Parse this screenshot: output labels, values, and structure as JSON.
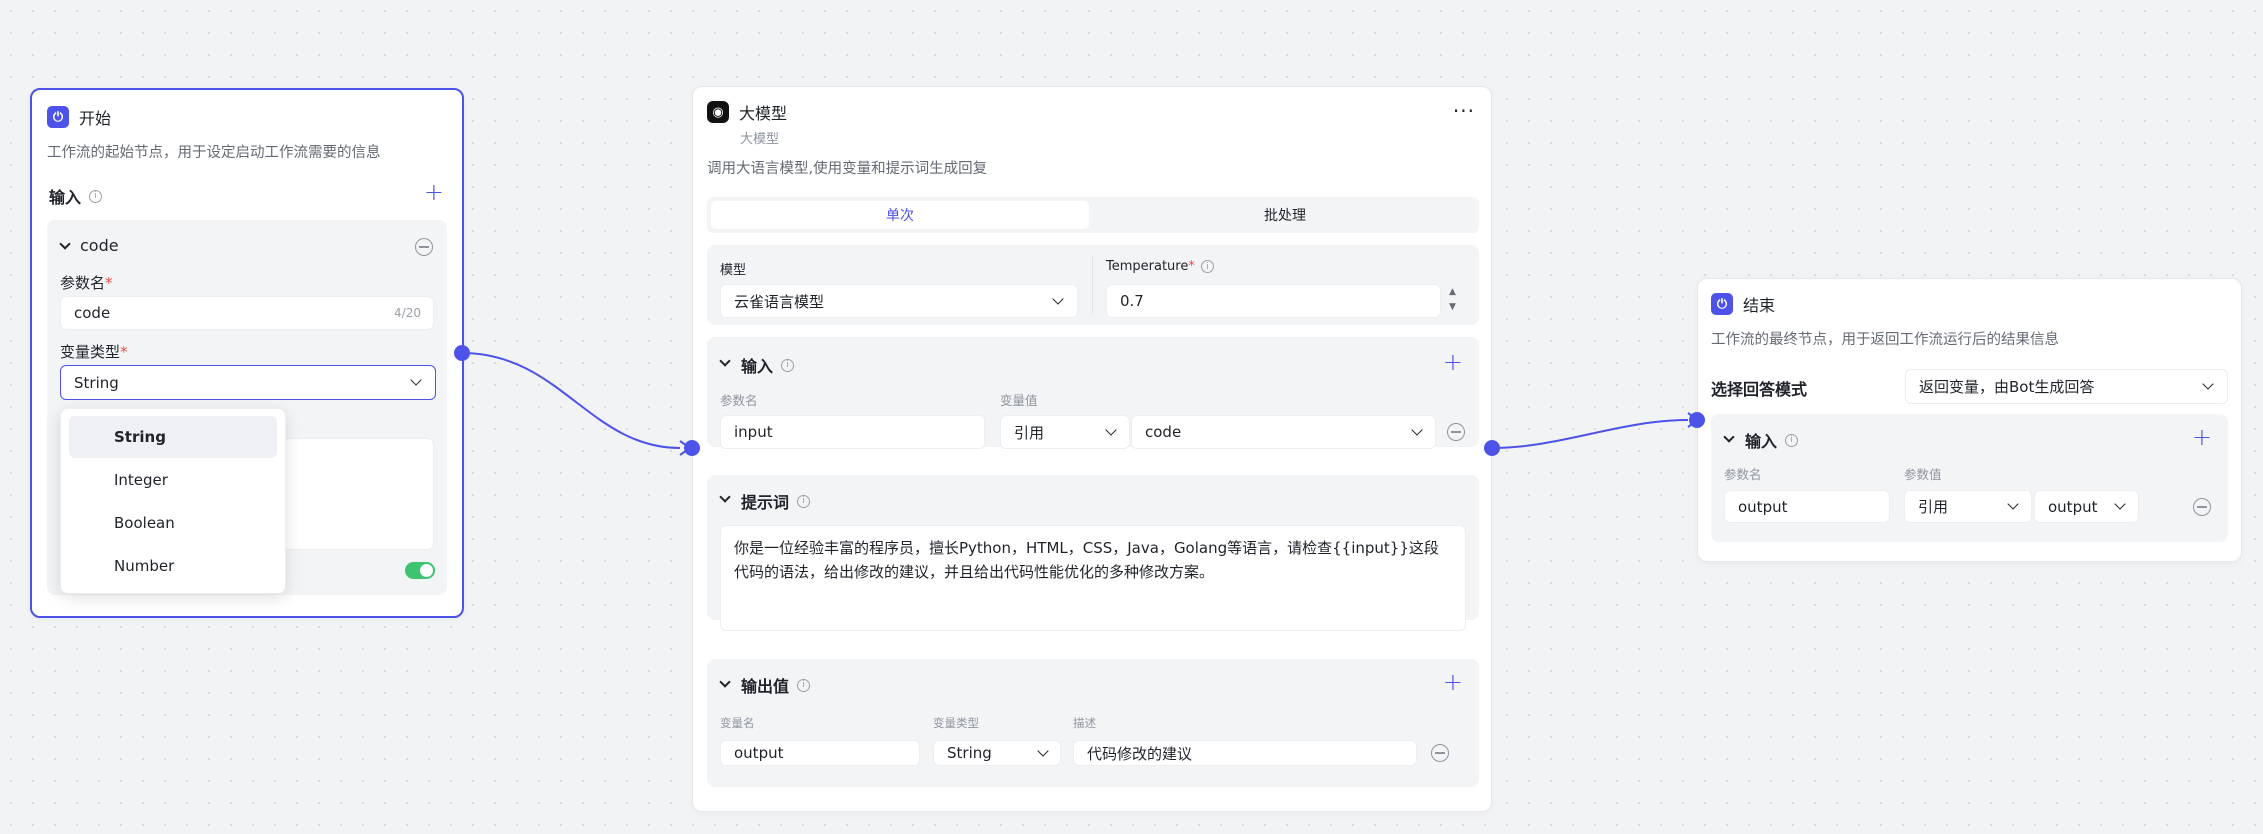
{
  "start_node": {
    "title": "开始",
    "desc": "工作流的起始节点，用于设定启动工作流需要的信息",
    "input_label": "输入",
    "param": {
      "name": "code",
      "param_name_label": "参数名",
      "param_name_value": "code",
      "param_name_count": "4/20",
      "var_type_label": "变量类型",
      "var_type_value": "String"
    },
    "dropdown_options": [
      "String",
      "Integer",
      "Boolean",
      "Number"
    ],
    "dropdown_selected": "String"
  },
  "llm_node": {
    "title": "大模型",
    "subtitle": "大模型",
    "desc": "调用大语言模型,使用变量和提示词生成回复",
    "tabs": [
      "单次",
      "批处理"
    ],
    "active_tab": "单次",
    "model_label": "模型",
    "model_value": "云雀语言模型",
    "temperature_label": "Temperature",
    "temperature_value": "0.7",
    "input_section": {
      "title": "输入",
      "col_param_name": "参数名",
      "col_var_value": "变量值",
      "row": {
        "name": "input",
        "ref_type": "引用",
        "ref_value": "code"
      }
    },
    "prompt_section": {
      "title": "提示词",
      "text": "你是一位经验丰富的程序员，擅长Python，HTML，CSS，Java，Golang等语言，请检查{{input}}这段代码的语法，给出修改的建议，并且给出代码性能优化的多种修改方案。"
    },
    "output_section": {
      "title": "输出值",
      "col_var_name": "变量名",
      "col_var_type": "变量类型",
      "col_desc": "描述",
      "row": {
        "name": "output",
        "type": "String",
        "desc": "代码修改的建议"
      }
    }
  },
  "end_node": {
    "title": "结束",
    "desc": "工作流的最终节点，用于返回工作流运行后的结果信息",
    "mode_label": "选择回答模式",
    "mode_value": "返回变量，由Bot生成回答",
    "input_section": {
      "title": "输入",
      "col_param_name": "参数名",
      "col_param_value": "参数值",
      "row": {
        "name": "output",
        "ref_type": "引用",
        "ref_value": "output"
      }
    }
  },
  "colors": {
    "accent": "#4d53e8",
    "toggle_on": "#3ec36f",
    "required": "#f54a45"
  },
  "icons": [
    "start-icon",
    "llm-icon",
    "end-icon",
    "info-icon",
    "plus-icon",
    "minus-circle-icon",
    "chevron-down-icon",
    "more-icon"
  ]
}
